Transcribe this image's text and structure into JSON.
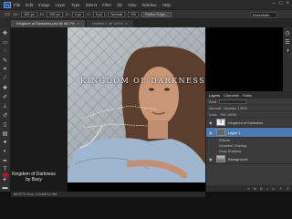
{
  "app": {
    "logo": "Ps",
    "menu": [
      "File",
      "Edit",
      "Image",
      "Layer",
      "Type",
      "Select",
      "Filter",
      "3D",
      "View",
      "Window",
      "Help"
    ],
    "workspace": "Essentials"
  },
  "options_bar": {
    "fields": [
      "100 px",
      "100 px",
      "0 px",
      "0 px",
      "Normal",
      "0%"
    ],
    "labels": [
      "W:",
      "H:",
      "X:",
      "Y:"
    ],
    "buttons": [
      "Refine Edge..."
    ]
  },
  "tabs": [
    {
      "label": "Kingdom of Darkness.psd @ 66.7%",
      "active": true
    },
    {
      "label": "Untitled-1 @ 100%",
      "active": false
    }
  ],
  "canvas": {
    "title_text": "KINGDOM OF DARKNESS"
  },
  "preview": {
    "caption_line1": "Kingdom of Darkness",
    "caption_line2": "by Bacy"
  },
  "layers_panel": {
    "tabs": [
      "Layers",
      "Channels",
      "Paths"
    ],
    "filter_label": "Kind",
    "blend_mode": "Normal",
    "opacity": "Opacity: 100%",
    "lock_label": "Lock:",
    "fill": "Fill: 100%",
    "layers": [
      {
        "name": "Kingdom of Darkness",
        "type": "text",
        "selected": false
      },
      {
        "name": "Layer 1",
        "type": "pixel",
        "selected": true
      },
      {
        "name": "Effects",
        "type": "fx",
        "selected": false
      },
      {
        "name": "Gradient Overlay",
        "type": "fx",
        "selected": false
      },
      {
        "name": "Drop Shadow",
        "type": "fx",
        "selected": false
      },
      {
        "name": "Background",
        "type": "photo",
        "selected": false
      }
    ]
  },
  "status": {
    "zoom": "66.67%",
    "doc": "Doc: 2.64M/12.4M"
  },
  "colors": {
    "foreground": "#d02525",
    "background": "#ffffff",
    "selection": "#4d7ab0"
  }
}
